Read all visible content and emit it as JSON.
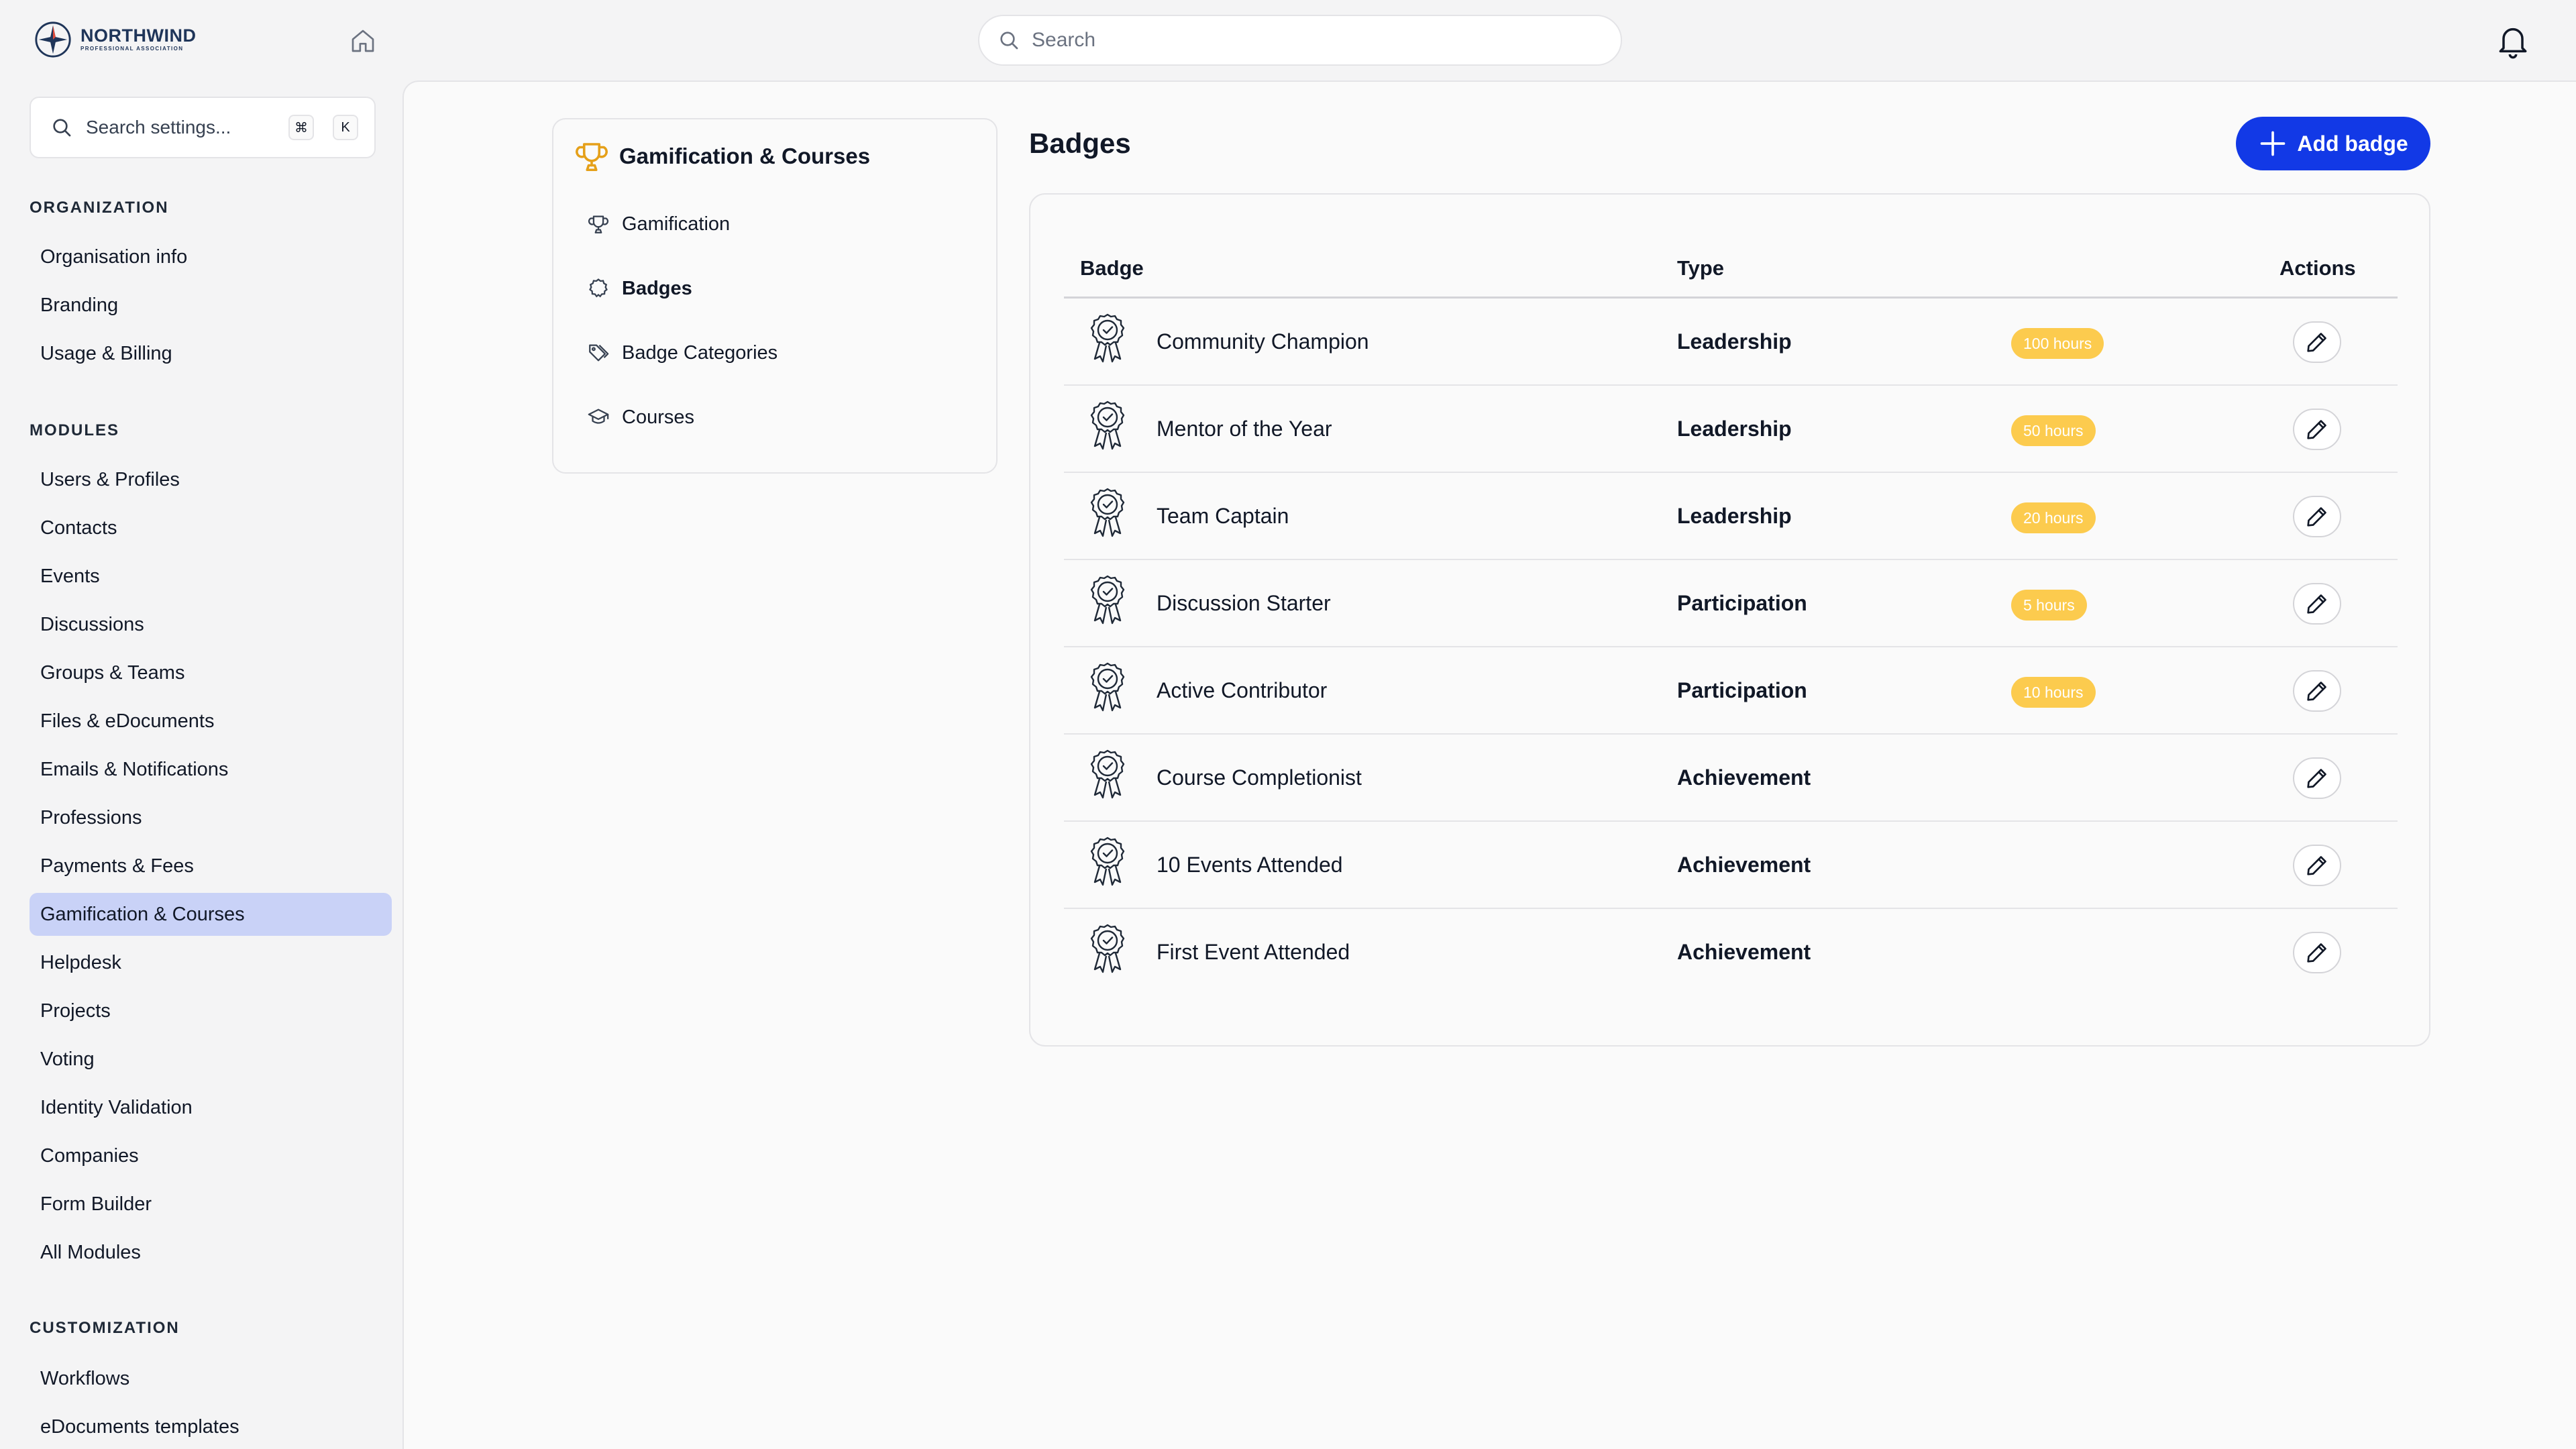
{
  "header": {
    "logo_name": "NORTHWIND",
    "logo_sub": "PROFESSIONAL ASSOCIATION",
    "search_placeholder": "Search"
  },
  "sidebar": {
    "search_placeholder": "Search settings...",
    "shortcut_keys": [
      "⌘",
      "K"
    ],
    "sections": [
      {
        "title": "ORGANIZATION",
        "items": [
          "Organisation info",
          "Branding",
          "Usage & Billing"
        ]
      },
      {
        "title": "MODULES",
        "items": [
          "Users & Profiles",
          "Contacts",
          "Events",
          "Discussions",
          "Groups & Teams",
          "Files & eDocuments",
          "Emails & Notifications",
          "Professions",
          "Payments & Fees",
          "Gamification & Courses",
          "Helpdesk",
          "Projects",
          "Voting",
          "Identity Validation",
          "Companies",
          "Form Builder",
          "All Modules"
        ]
      },
      {
        "title": "CUSTOMIZATION",
        "items": [
          "Workflows",
          "eDocuments templates"
        ]
      }
    ],
    "active_item": "Gamification & Courses"
  },
  "subnav": {
    "title": "Gamification & Courses",
    "items": [
      {
        "label": "Gamification",
        "icon": "trophy-icon"
      },
      {
        "label": "Badges",
        "icon": "badge-icon"
      },
      {
        "label": "Badge Categories",
        "icon": "tag-icon"
      },
      {
        "label": "Courses",
        "icon": "graduation-cap-icon"
      }
    ],
    "active_item": "Badges"
  },
  "page": {
    "title": "Badges",
    "add_button": "Add badge"
  },
  "table": {
    "columns": [
      "Badge",
      "Type",
      "Actions"
    ],
    "rows": [
      {
        "name": "Community Champion",
        "type": "Leadership",
        "hours": "100 hours"
      },
      {
        "name": "Mentor of the Year",
        "type": "Leadership",
        "hours": "50 hours"
      },
      {
        "name": "Team Captain",
        "type": "Leadership",
        "hours": "20 hours"
      },
      {
        "name": "Discussion Starter",
        "type": "Participation",
        "hours": "5 hours"
      },
      {
        "name": "Active Contributor",
        "type": "Participation",
        "hours": "10 hours"
      },
      {
        "name": "Course Completionist",
        "type": "Achievement",
        "hours": ""
      },
      {
        "name": "10 Events Attended",
        "type": "Achievement",
        "hours": ""
      },
      {
        "name": "First Event Attended",
        "type": "Achievement",
        "hours": ""
      }
    ]
  },
  "colors": {
    "accent": "#1239e6",
    "active_nav": "#c9d2f7",
    "pill": "#fccb4e",
    "trophy": "#e5a019"
  }
}
